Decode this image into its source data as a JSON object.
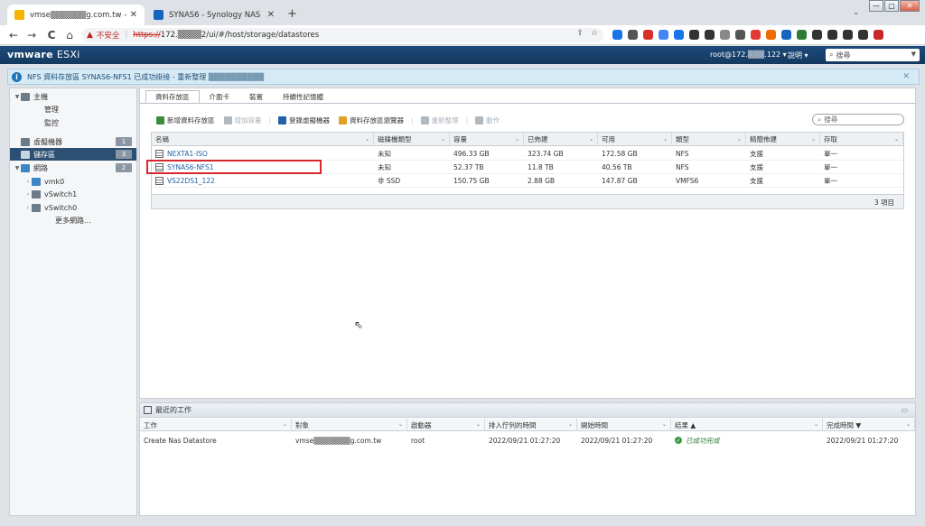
{
  "browser": {
    "tabs": [
      {
        "title": "vmse▒▒▒▒▒▒g.com.tw - VMw",
        "favicon_color": "#f4b400",
        "active": true
      },
      {
        "title": "SYNAS6 - Synology NAS",
        "favicon_color": "#1565c0",
        "active": false
      }
    ],
    "new_tab": "+",
    "tab_menu": "⌄",
    "window_controls": [
      "—",
      "▢",
      "✕"
    ],
    "nav": {
      "back": "←",
      "forward": "→",
      "reload": "C",
      "home": "⌂"
    },
    "address": {
      "warning_icon": "▲",
      "insecure_label": "不安全",
      "separator": "|",
      "protocol": "https://",
      "rest": "172.▒▒▒▒2/ui/#/host/storage/datastores"
    },
    "extension_colors": [
      "#1a73e8",
      "#555555",
      "#d93025",
      "#4285f4",
      "#1a73e8",
      "#333333",
      "#333333",
      "#888888",
      "#555555",
      "#e53935",
      "#ef6c00",
      "#1565c0",
      "#2e7d32",
      "#333333",
      "#333333",
      "#333333",
      "#333333",
      "#c62828"
    ]
  },
  "esxi": {
    "logo": "vmware",
    "product": "ESXi",
    "user": "root@172.▒▒▒.122 ▾",
    "help": "說明 ▾",
    "search_placeholder": "搜尋",
    "notification": "NFS 資料存放區 SYNAS6-NFS1 已成功掛接 - 重新整理 ▒▒▒▒▒▒▒▒▒▒",
    "notification_close": "✕"
  },
  "navigator": {
    "items": [
      {
        "label": "主機",
        "toggle": "▼",
        "indent": 0,
        "selected": false,
        "badge": "",
        "icon_color": "#6d7b89"
      },
      {
        "label": "管理",
        "toggle": "",
        "indent": 1,
        "selected": false,
        "badge": "",
        "icon_color": ""
      },
      {
        "label": "監控",
        "toggle": "",
        "indent": 1,
        "selected": false,
        "badge": "",
        "icon_color": ""
      },
      {
        "label": "虛擬機器",
        "toggle": "",
        "indent": 0,
        "selected": false,
        "badge": "1",
        "icon_color": "#6d7b89"
      },
      {
        "label": "儲存區",
        "toggle": "",
        "indent": 0,
        "selected": true,
        "badge": "3",
        "icon_color": "#c9d5e1"
      },
      {
        "label": "網路",
        "toggle": "▼",
        "indent": 0,
        "selected": false,
        "badge": "2",
        "icon_color": "#3d85c6"
      },
      {
        "label": "vmk0",
        "toggle": "›",
        "indent": 1,
        "selected": false,
        "badge": "",
        "icon_color": "#3d85c6"
      },
      {
        "label": "vSwitch1",
        "toggle": "›",
        "indent": 1,
        "selected": false,
        "badge": "",
        "icon_color": "#6d7b89"
      },
      {
        "label": "vSwitch0",
        "toggle": "›",
        "indent": 1,
        "selected": false,
        "badge": "",
        "icon_color": "#6d7b89"
      },
      {
        "label": "更多網路...",
        "toggle": "",
        "indent": 2,
        "selected": false,
        "badge": "",
        "icon_color": ""
      }
    ]
  },
  "main": {
    "tabs": [
      "資料存放區",
      "介面卡",
      "裝置",
      "持續性記憶體"
    ],
    "toolbar": [
      {
        "label": "新增資料存放區",
        "disabled": false,
        "icon_color": "#3b8d3e"
      },
      {
        "label": "增加容量",
        "disabled": true,
        "icon_color": "#b0b8c0"
      },
      {
        "label": "登錄虛擬機器",
        "disabled": false,
        "icon_color": "#1f63a6"
      },
      {
        "label": "資料存放區瀏覽器",
        "disabled": false,
        "icon_color": "#e0a020"
      },
      {
        "label": "重新整理",
        "disabled": true,
        "icon_color": "#b0b8c0"
      },
      {
        "label": "動作",
        "disabled": true,
        "icon_color": "#b0b8c0"
      }
    ],
    "search_placeholder": "搜尋",
    "columns": [
      "名稱",
      "磁碟機類型",
      "容量",
      "已佈建",
      "可用",
      "類型",
      "精簡佈建",
      "存取"
    ],
    "rows": [
      [
        "NEXTA1-ISO",
        "未知",
        "496.33 GB",
        "323.74 GB",
        "172.58 GB",
        "NFS",
        "支援",
        "單一"
      ],
      [
        "SYNAS6-NFS1",
        "未知",
        "52.37 TB",
        "11.8 TB",
        "40.56 TB",
        "NFS",
        "支援",
        "單一"
      ],
      [
        "VS22DS1_122",
        "非 SSD",
        "150.75 GB",
        "2.88 GB",
        "147.87 GB",
        "VMFS6",
        "支援",
        "單一"
      ]
    ],
    "count": "3 項目"
  },
  "tasks": {
    "title": "最近的工作",
    "maximize": "▭",
    "columns": [
      "工作",
      "對象",
      "啟動器",
      "排入佇列的時間",
      "開始時間",
      "結果 ▲",
      "完成時間 ▼"
    ],
    "rows": [
      [
        "Create Nas Datastore",
        "vmse▒▒▒▒▒▒▒g.com.tw",
        "root",
        "2022/09/21 01:27:20",
        "2022/09/21 01:27:20",
        "已成功完成",
        "2022/09/21 01:27:20"
      ]
    ],
    "check": "✓"
  }
}
